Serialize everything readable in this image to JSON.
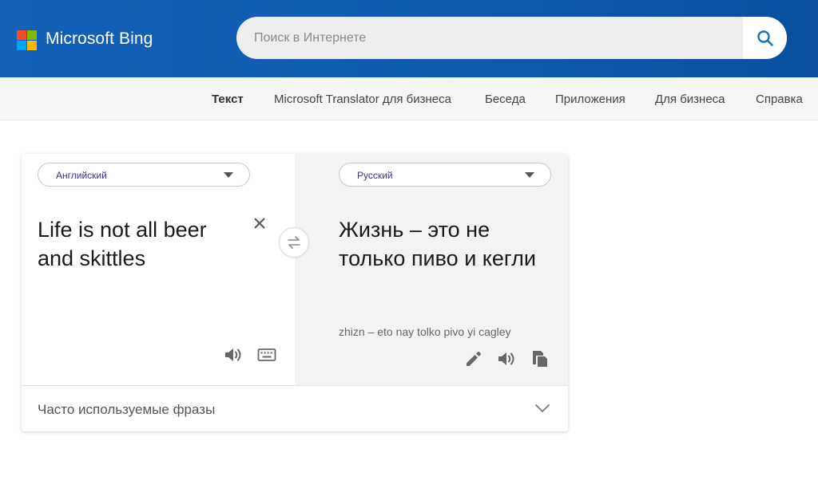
{
  "header": {
    "brand": "Microsoft Bing",
    "logo_colors": [
      "#f25022",
      "#7fba00",
      "#00a4ef",
      "#ffb900"
    ],
    "search_placeholder": "Поиск в Интернете",
    "search_icon": "search-icon"
  },
  "nav": {
    "items": [
      {
        "label": "Текст",
        "active": true
      },
      {
        "label": "Microsoft Translator для бизнеса",
        "active": false
      },
      {
        "label": "Беседа",
        "active": false
      },
      {
        "label": "Приложения",
        "active": false
      },
      {
        "label": "Для бизнеса",
        "active": false
      },
      {
        "label": "Справка",
        "active": false
      }
    ]
  },
  "translator": {
    "source_language": "Английский",
    "target_language": "Русский",
    "source_text": "Life is not all beer and skittles",
    "translated_text": "Жизнь – это не только пиво и кегли",
    "transliteration": "zhizn – eto nay tolko pivo yi cagley",
    "icons": {
      "clear": "close-icon",
      "swap": "swap-icon",
      "source_speak": "speaker-icon",
      "keyboard": "keyboard-icon",
      "edit": "pencil-icon",
      "target_speak": "speaker-icon",
      "copy": "copy-icon"
    }
  },
  "phrases": {
    "label": "Часто используемые фразы",
    "icon": "chevron-down-icon"
  },
  "colors": {
    "header_bg": "#0f5cb3",
    "lang_label": "#3c2e8e",
    "search_icon": "#1a73c9"
  }
}
